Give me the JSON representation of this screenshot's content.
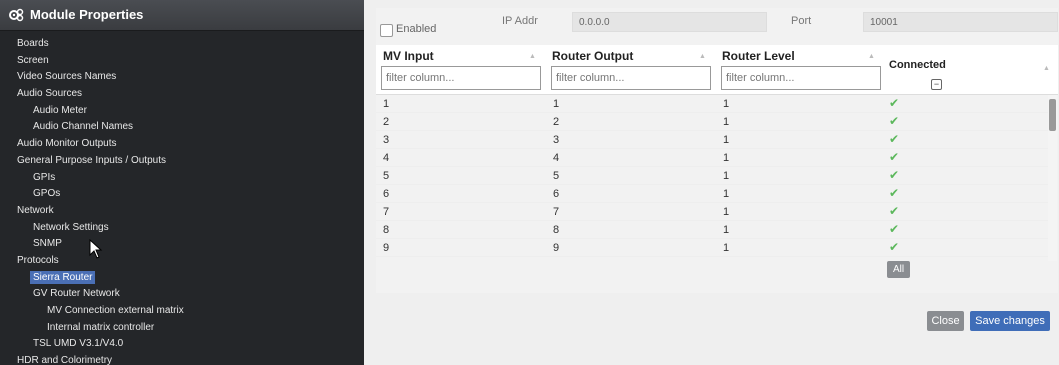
{
  "sidebar": {
    "title": "Module Properties",
    "items": [
      {
        "label": "Boards",
        "level": 0
      },
      {
        "label": "Screen",
        "level": 0
      },
      {
        "label": "Video Sources Names",
        "level": 0
      },
      {
        "label": "Audio Sources",
        "level": 0
      },
      {
        "label": "Audio Meter",
        "level": 1
      },
      {
        "label": "Audio Channel Names",
        "level": 1
      },
      {
        "label": "Audio Monitor Outputs",
        "level": 0
      },
      {
        "label": "General Purpose Inputs / Outputs",
        "level": 0
      },
      {
        "label": "GPIs",
        "level": 1
      },
      {
        "label": "GPOs",
        "level": 1
      },
      {
        "label": "Network",
        "level": 0
      },
      {
        "label": "Network Settings",
        "level": 1
      },
      {
        "label": "SNMP",
        "level": 1
      },
      {
        "label": "Protocols",
        "level": 0
      },
      {
        "label": "Sierra Router",
        "level": 1,
        "selected": true
      },
      {
        "label": "GV Router Network",
        "level": 1
      },
      {
        "label": "MV Connection external matrix",
        "level": 2
      },
      {
        "label": "Internal matrix controller",
        "level": 2
      },
      {
        "label": "TSL UMD V3.1/V4.0",
        "level": 1
      },
      {
        "label": "HDR and Colorimetry",
        "level": 0
      }
    ]
  },
  "top": {
    "enabled_label": "Enabled",
    "ip_label": "IP Addr",
    "ip_value": "0.0.0.0",
    "port_label": "Port",
    "port_value": "10001"
  },
  "table": {
    "columns": [
      "MV Input",
      "Router Output",
      "Router Level",
      "Connected"
    ],
    "filter_placeholder": "filter column...",
    "rows": [
      [
        "1",
        "1",
        "1",
        "✔"
      ],
      [
        "2",
        "2",
        "1",
        "✔"
      ],
      [
        "3",
        "3",
        "1",
        "✔"
      ],
      [
        "4",
        "4",
        "1",
        "✔"
      ],
      [
        "5",
        "5",
        "1",
        "✔"
      ],
      [
        "6",
        "6",
        "1",
        "✔"
      ],
      [
        "7",
        "7",
        "1",
        "✔"
      ],
      [
        "8",
        "8",
        "1",
        "✔"
      ],
      [
        "9",
        "9",
        "1",
        "✔"
      ]
    ],
    "all_label": "All"
  },
  "footer": {
    "close_label": "Close",
    "save_label": "Save changes"
  },
  "colors": {
    "accent": "#3f6db8",
    "check": "#5cb85c",
    "sidebar_bg": "#242629"
  }
}
